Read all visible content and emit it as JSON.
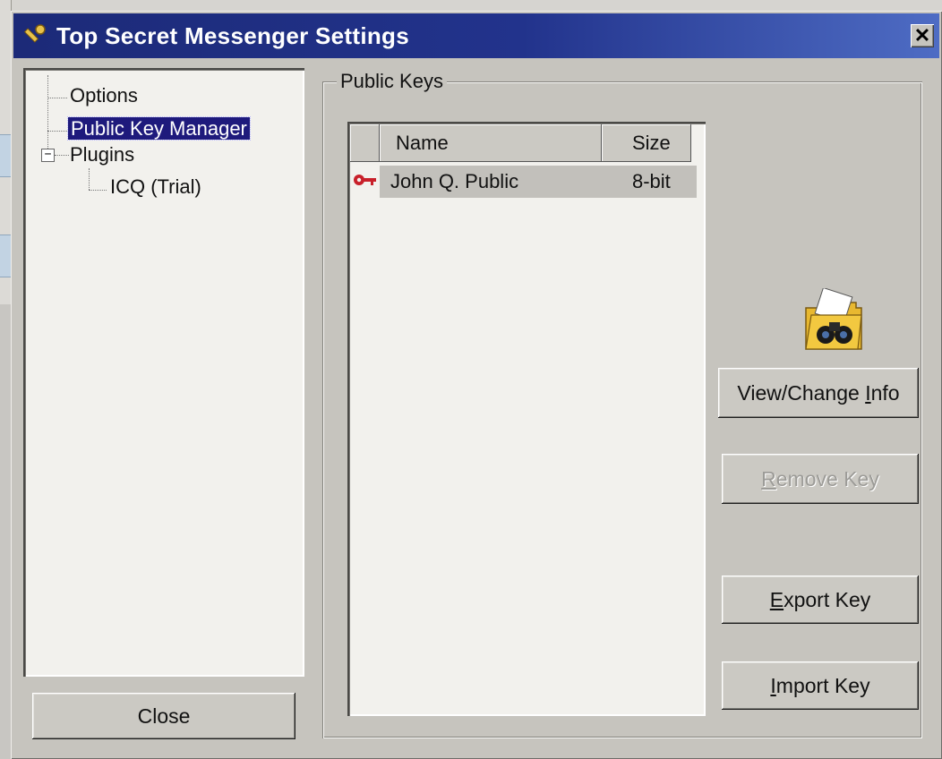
{
  "window": {
    "title": "Top Secret Messenger Settings",
    "close_glyph": "✕"
  },
  "tree": {
    "items": [
      {
        "label": "Options"
      },
      {
        "label": "Public Key Manager",
        "selected": true
      },
      {
        "label": "Plugins",
        "expanded": true,
        "expander": "−"
      },
      {
        "label": "ICQ (Trial)"
      }
    ]
  },
  "close_button": {
    "label": "Close"
  },
  "public_keys": {
    "group_label": "Public Keys",
    "columns": [
      "Name",
      "Size"
    ],
    "rows": [
      {
        "name": "John Q. Public",
        "size": "8-bit",
        "icon": "key-icon"
      }
    ]
  },
  "actions": {
    "view_change_info": {
      "prefix": "View/Change ",
      "accel": "I",
      "suffix": "nfo"
    },
    "remove_key": {
      "accel": "R",
      "suffix": "emove Key",
      "disabled": true
    },
    "export_key": {
      "accel": "E",
      "suffix": "xport Key"
    },
    "import_key": {
      "accel": "I",
      "suffix": "mport Key"
    }
  },
  "colors": {
    "title_start": "#1c2a78",
    "title_end": "#4e6cc4",
    "selection": "#1e1a7c",
    "key_red": "#c8202a",
    "folder_yellow": "#e8b830"
  }
}
